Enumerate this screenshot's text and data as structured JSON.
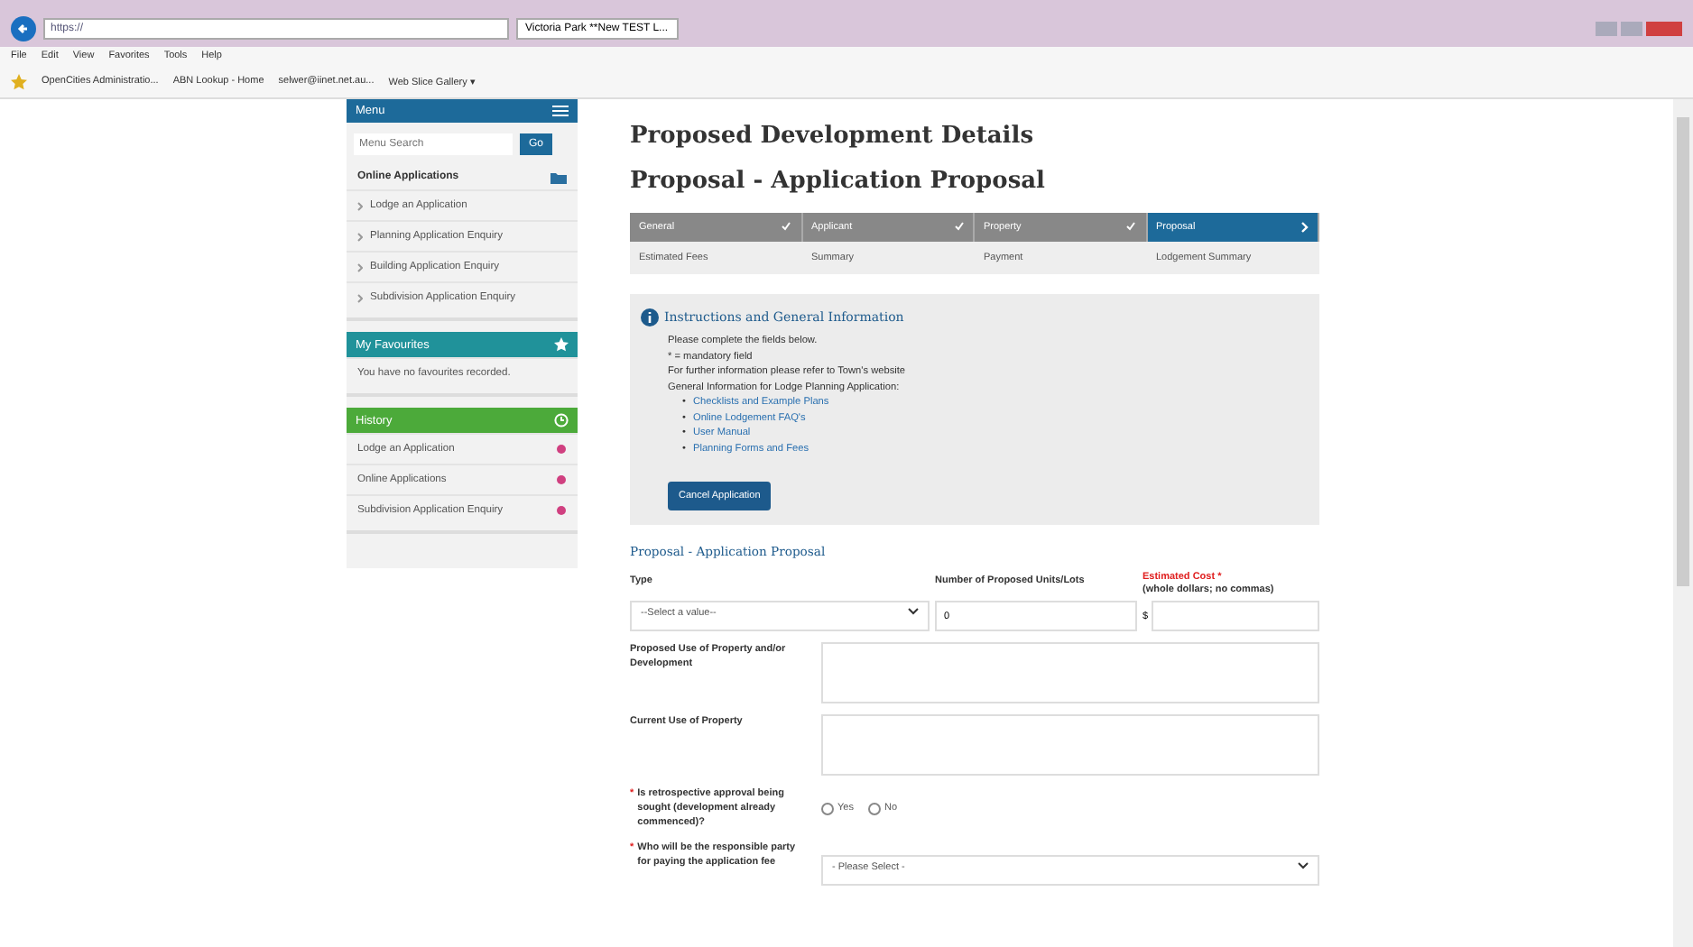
{
  "browser": {
    "address": "https://",
    "tab": "Victoria Park **New TEST L...",
    "menu_bar": [
      "File",
      "Edit",
      "View",
      "Favorites",
      "Tools",
      "Help"
    ],
    "favorites": [
      "OpenCities Administratio...",
      "ABN Lookup - Home",
      "selwer@iinet.net.au...",
      "Web Slice Gallery ▾"
    ]
  },
  "sidebar": {
    "menu": {
      "title": "Menu",
      "search_placeholder": "Menu Search",
      "go": "Go",
      "section": "Online Applications",
      "items": [
        "Lodge an Application",
        "Planning Application Enquiry",
        "Building Application Enquiry",
        "Subdivision Application Enquiry"
      ]
    },
    "favourites": {
      "title": "My Favourites",
      "empty": "You have no favourites recorded."
    },
    "history": {
      "title": "History",
      "items": [
        "Lodge an Application",
        "Online Applications",
        "Subdivision Application Enquiry"
      ]
    }
  },
  "main": {
    "title": "Proposed Development Details",
    "subtitle": "Proposal - Application Proposal",
    "steps": [
      {
        "label": "General",
        "done": true,
        "selected": false
      },
      {
        "label": "Applicant",
        "done": true,
        "selected": false
      },
      {
        "label": "Property",
        "done": true,
        "selected": false
      },
      {
        "label": "Proposal",
        "done": false,
        "selected": true
      }
    ],
    "substeps": [
      "Estimated Fees",
      "Summary",
      "Payment",
      "Lodgement Summary"
    ],
    "info": {
      "title": "Instructions and General Information",
      "lines": [
        "Please complete the fields below.",
        "* = mandatory field",
        "For further information please refer to Town's website",
        "General Information for Lodge Planning Application:"
      ],
      "bullet": "•",
      "links": [
        "Checklists and Example Plans",
        "Online Lodgement FAQ's",
        "User Manual",
        "Planning Forms and Fees"
      ],
      "cancel": "Cancel Application"
    },
    "form": {
      "title": "Proposal - Application Proposal",
      "type": {
        "label": "Type",
        "value": "--Select a value--"
      },
      "units": {
        "label": "Number of Proposed Units/Lots",
        "value": "0"
      },
      "cost": {
        "label": "Estimated Cost *",
        "hint": "(whole dollars; no commas)",
        "prefix": "$"
      },
      "proposed_use": {
        "label": "Proposed Use of Property and/or Development"
      },
      "current_use": {
        "label": "Current Use of Property"
      },
      "retrospective": {
        "marker": "*",
        "label": "Is retrospective approval being sought (development already commenced)?",
        "options": [
          {
            "label": "Yes",
            "selected": false
          },
          {
            "label": "No",
            "selected": false
          }
        ]
      },
      "payer": {
        "marker": "*",
        "label": "Who will be the responsible party for paying the application fee",
        "value": "- Please Select -"
      }
    }
  }
}
